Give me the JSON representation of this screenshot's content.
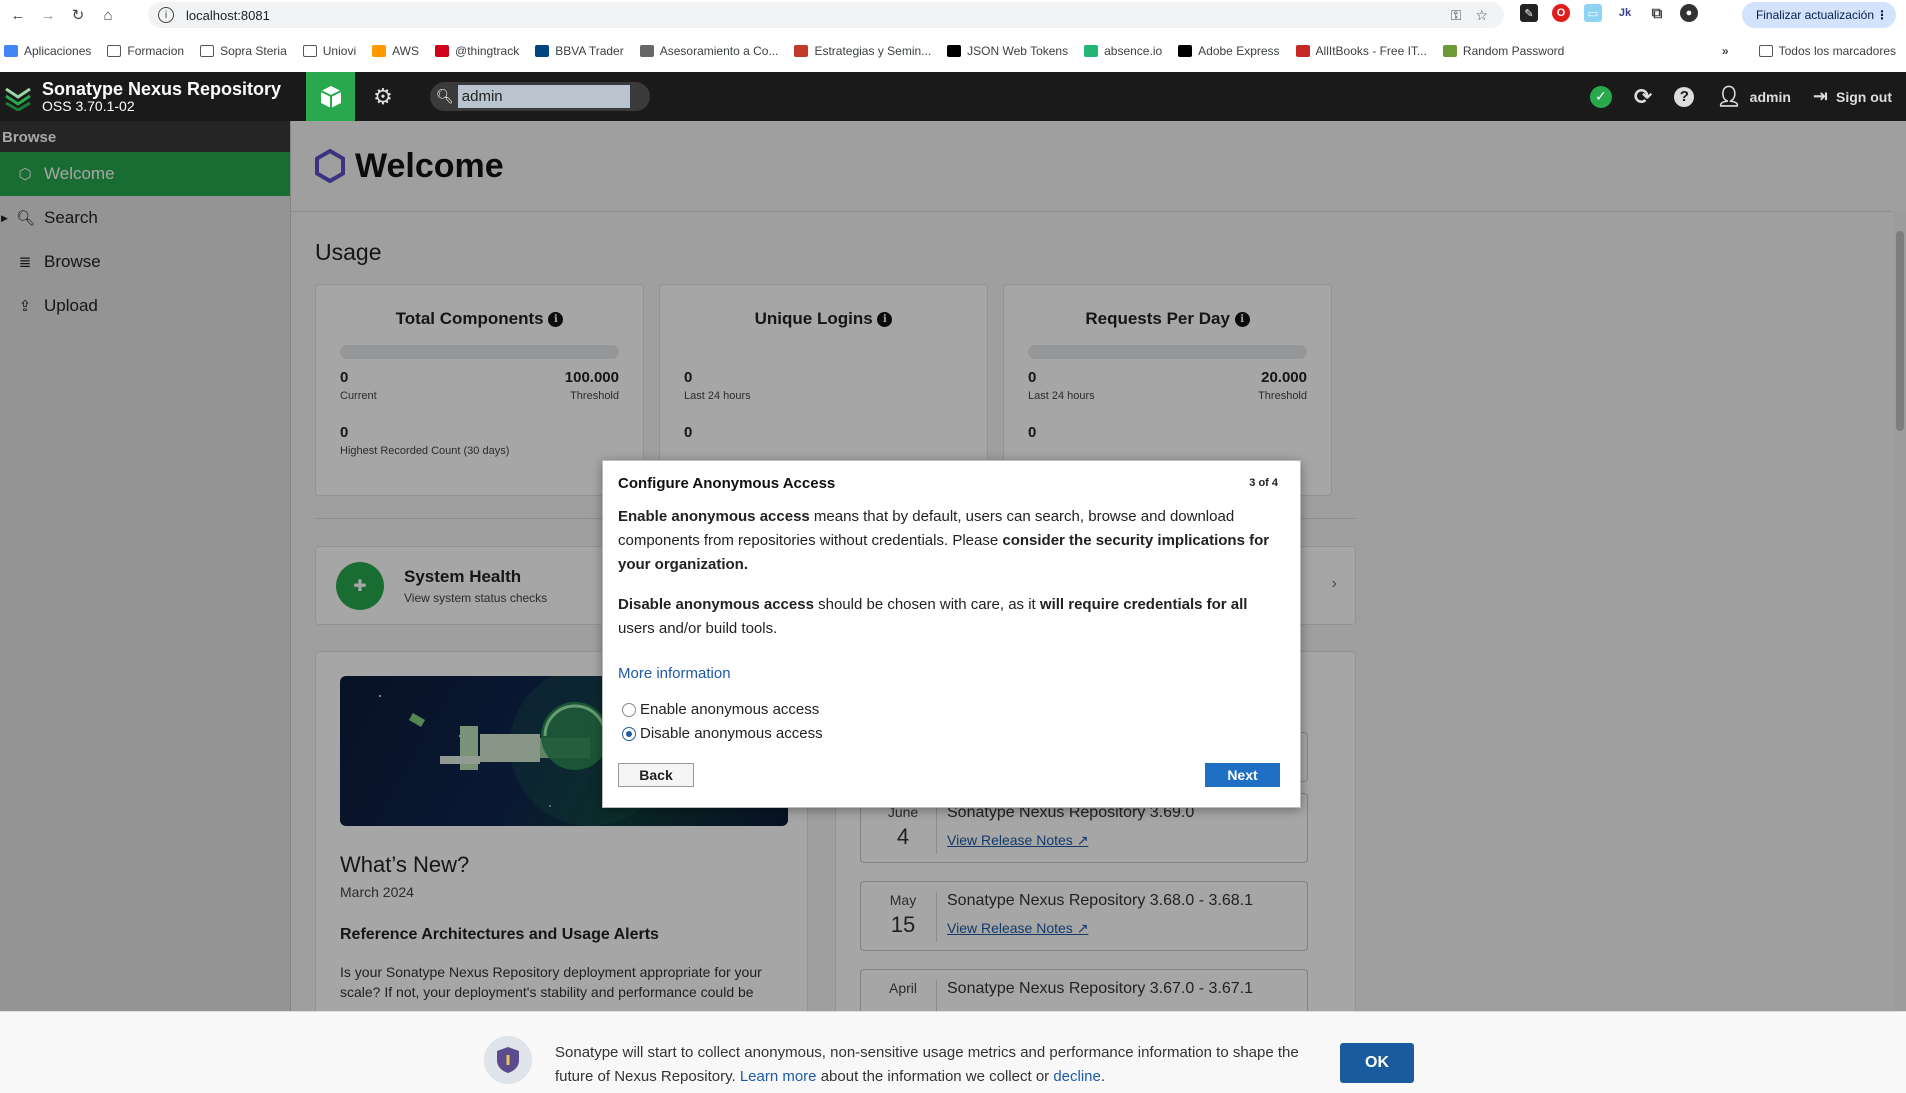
{
  "browser": {
    "url": "localhost:8081",
    "update_button": "Finalizar actualización",
    "bookmarks": [
      {
        "label": "Aplicaciones",
        "icon": "apps-grid-icon",
        "color": "#4285f4"
      },
      {
        "label": "Formacion",
        "icon": "folder-icon",
        "color": ""
      },
      {
        "label": "Sopra Steria",
        "icon": "folder-icon",
        "color": ""
      },
      {
        "label": "Uniovi",
        "icon": "folder-icon",
        "color": ""
      },
      {
        "label": "AWS",
        "icon": "aws-icon",
        "color": "#ff9900"
      },
      {
        "label": "@thingtrack",
        "icon": "thingtrack-icon",
        "color": "#d0021b"
      },
      {
        "label": "BBVA Trader",
        "icon": "bbva-icon",
        "color": "#004481"
      },
      {
        "label": "Asesoramiento a Co...",
        "icon": "gear-icon",
        "color": "#666666"
      },
      {
        "label": "Estrategias y Semin...",
        "icon": "e-icon",
        "color": "#c0392b"
      },
      {
        "label": "JSON Web Tokens",
        "icon": "jwt-icon",
        "color": "#000000"
      },
      {
        "label": "absence.io",
        "icon": "absence-icon",
        "color": "#22b573"
      },
      {
        "label": "Adobe Express",
        "icon": "adobe-icon",
        "color": "#000000"
      },
      {
        "label": "AllItBooks - Free IT...",
        "icon": "book-icon",
        "color": "#c62828"
      },
      {
        "label": "Random Password",
        "icon": "password-icon",
        "color": "#6d9b3a"
      }
    ],
    "all_bookmarks": "Todos los marcadores"
  },
  "header": {
    "product_title": "Sonatype Nexus Repository",
    "product_version": "OSS 3.70.1-02",
    "search_value": "admin",
    "user_name": "admin",
    "sign_out": "Sign out"
  },
  "sidebar": {
    "section": "Browse",
    "items": [
      {
        "label": "Welcome",
        "icon": "hexagon-icon"
      },
      {
        "label": "Search",
        "icon": "search-icon"
      },
      {
        "label": "Browse",
        "icon": "database-icon"
      },
      {
        "label": "Upload",
        "icon": "upload-icon"
      }
    ]
  },
  "main": {
    "title": "Welcome",
    "usage_title": "Usage",
    "metrics": [
      {
        "title": "Total Components",
        "value": "0",
        "value_label": "Current",
        "threshold": "100.000",
        "threshold_label": "Threshold",
        "highest": "0",
        "highest_label": "Highest Recorded Count (30 days)"
      },
      {
        "title": "Unique Logins",
        "value": "0",
        "value_label": "Last 24 hours",
        "threshold": "",
        "threshold_label": "",
        "highest": "0",
        "highest_label": ""
      },
      {
        "title": "Requests Per Day",
        "value": "0",
        "value_label": "Last 24 hours",
        "threshold": "20.000",
        "threshold_label": "Threshold",
        "highest": "0",
        "highest_label": ""
      }
    ],
    "health": {
      "title": "System Health",
      "subtitle": "View system status checks"
    },
    "news": {
      "title": "What’s New?",
      "date": "March 2024",
      "heading": "Reference Architectures and Usage Alerts",
      "paragraph": "Is your Sonatype Nexus Repository deployment appropriate for your scale? If not, your deployment's stability and performance could be"
    },
    "releases": [
      {
        "month": "June",
        "day": "4",
        "title": "Sonatype Nexus Repository 3.69.0",
        "link": "View Release Notes"
      },
      {
        "month": "May",
        "day": "15",
        "title": "Sonatype Nexus Repository 3.68.0 - 3.68.1",
        "link": "View Release Notes"
      },
      {
        "month": "April",
        "day": "",
        "title": "Sonatype Nexus Repository 3.67.0 - 3.67.1",
        "link": ""
      }
    ]
  },
  "modal": {
    "title": "Configure Anonymous Access",
    "step": "3 of 4",
    "p1_b1": "Enable anonymous access",
    "p1_t1": " means that by default, users can search, browse and download components from repositories without credentials. Please ",
    "p1_b2": "consider the security implications for your organization.",
    "p2_b1": "Disable anonymous access",
    "p2_t1": " should be chosen with care, as it ",
    "p2_b2": "will require credentials for all",
    "p2_t2": " users and/or build tools.",
    "more_info": "More information",
    "options": [
      {
        "label": "Enable anonymous access",
        "selected": false
      },
      {
        "label": "Disable anonymous access",
        "selected": true
      }
    ],
    "back": "Back",
    "next": "Next"
  },
  "footer": {
    "text1": "Sonatype will start to collect anonymous, non-sensitive usage metrics and performance information to shape the future of Nexus Repository. ",
    "learn_more": "Learn more",
    "text2": " about the information we collect or ",
    "decline": "decline",
    "text3": ".",
    "ok": "OK"
  },
  "colors": {
    "accent": "#29a84d",
    "link": "#1f5aa6",
    "primary_button": "#1f6fc5",
    "header_bg": "#1a1a1a"
  }
}
